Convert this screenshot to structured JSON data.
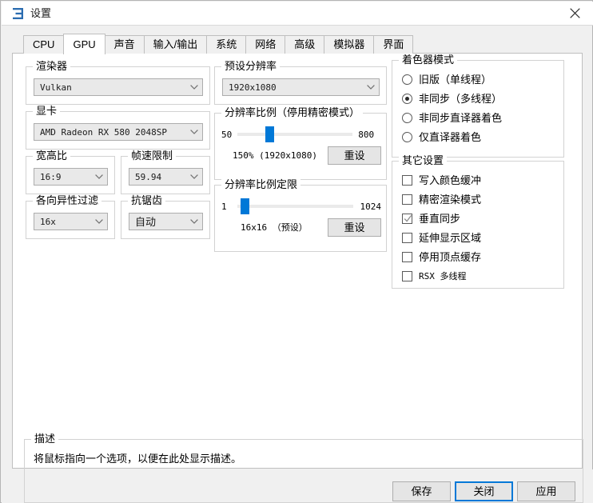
{
  "window": {
    "title": "设置",
    "app_icon": "settings-icon",
    "close_icon": "close-icon"
  },
  "tabs": [
    {
      "label": "CPU",
      "selected": false
    },
    {
      "label": "GPU",
      "selected": true
    },
    {
      "label": "声音",
      "selected": false
    },
    {
      "label": "输入/输出",
      "selected": false
    },
    {
      "label": "系统",
      "selected": false
    },
    {
      "label": "网络",
      "selected": false
    },
    {
      "label": "高级",
      "selected": false
    },
    {
      "label": "模拟器",
      "selected": false
    },
    {
      "label": "界面",
      "selected": false
    }
  ],
  "groups": {
    "renderer": {
      "legend": "渲染器",
      "value": "Vulkan"
    },
    "graphics_device": {
      "legend": "显卡",
      "value": "AMD Radeon RX 580 2048SP"
    },
    "aspect_ratio": {
      "legend": "宽高比",
      "value": "16:9"
    },
    "framelimit": {
      "legend": "帧速限制",
      "value": "59.94"
    },
    "anisotropic": {
      "legend": "各向异性过滤",
      "value": "16x"
    },
    "antialiasing": {
      "legend": "抗锯齿",
      "value": "自动"
    },
    "default_resolution": {
      "legend": "预设分辨率",
      "value": "1920x1080"
    },
    "resolution_scale": {
      "legend": "分辨率比例（停用精密模式）",
      "min": "50",
      "max": "800",
      "value_percent": 150,
      "caption": "150% (1920x1080)",
      "reset_label": "重设"
    },
    "resolution_scale_threshold": {
      "legend": "分辨率比例定限",
      "min": "1",
      "max": "1024",
      "value": 16,
      "caption": "16x16 （预设）",
      "reset_label": "重设"
    },
    "shader_mode": {
      "legend": "着色器模式",
      "options": [
        {
          "label": "旧版（单线程）",
          "selected": false
        },
        {
          "label": "非同步（多线程）",
          "selected": true
        },
        {
          "label": "非同步直译器着色",
          "selected": false
        },
        {
          "label": "仅直译器着色",
          "selected": false
        }
      ]
    },
    "other_settings": {
      "legend": "其它设置",
      "options": [
        {
          "label": "写入颜色缓冲",
          "checked": false,
          "mono": false
        },
        {
          "label": "精密渲染模式",
          "checked": false,
          "mono": false
        },
        {
          "label": "垂直同步",
          "checked": true,
          "mono": false
        },
        {
          "label": "延伸显示区域",
          "checked": false,
          "mono": false
        },
        {
          "label": "停用顶点缓存",
          "checked": false,
          "mono": false
        },
        {
          "label": "RSX 多线程",
          "checked": false,
          "mono": true
        }
      ]
    }
  },
  "description": {
    "legend": "描述",
    "text": "将鼠标指向一个选项，以便在此处显示描述。"
  },
  "footer": {
    "save_label": "保存",
    "close_label": "关闭",
    "apply_label": "应用"
  },
  "colors": {
    "accent": "#0078d7",
    "window_bg": "#f0f0f0",
    "panel_bg": "#ffffff",
    "group_border": "#d2d2d2"
  }
}
